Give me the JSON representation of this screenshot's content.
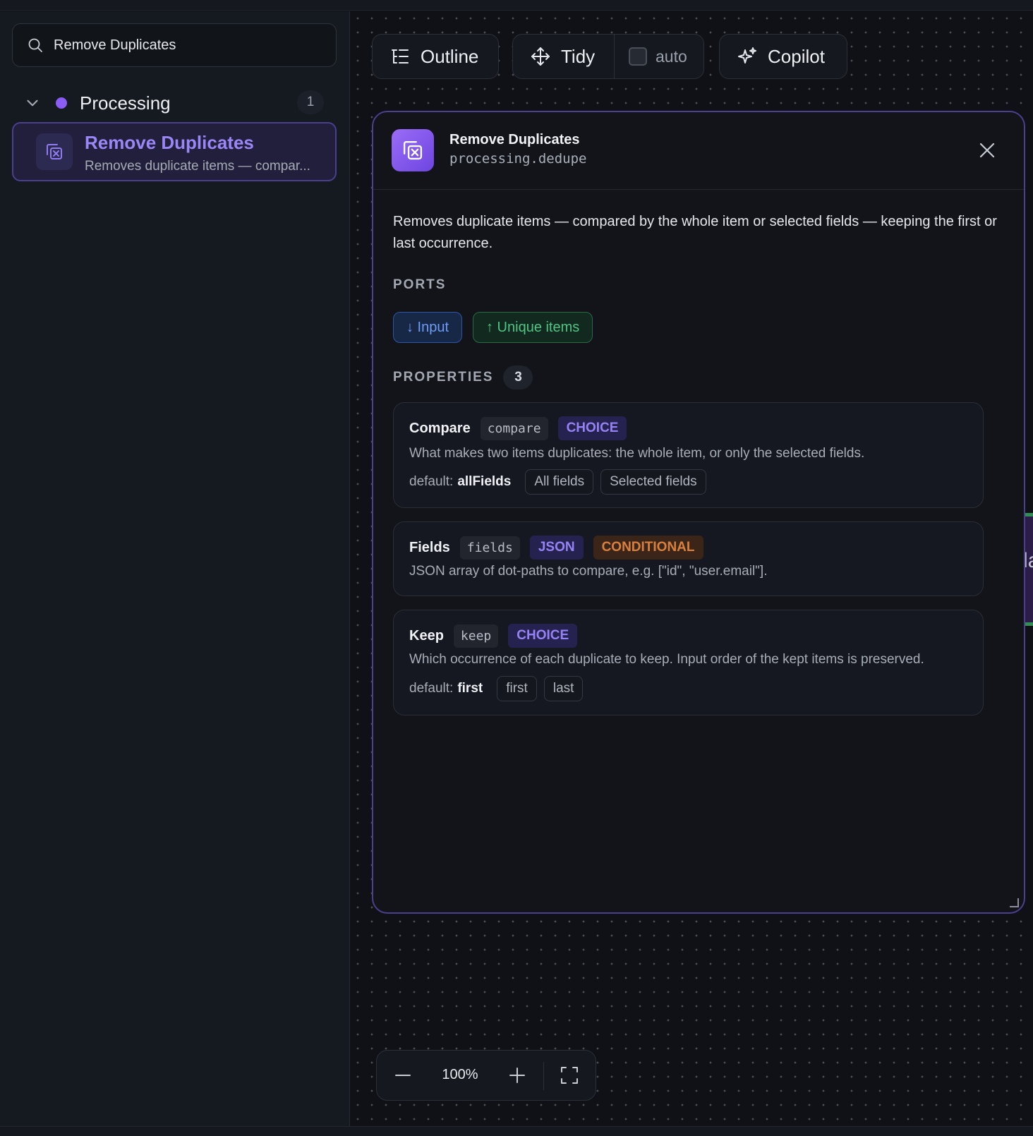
{
  "search": {
    "value": "Remove Duplicates"
  },
  "group": {
    "title": "Processing",
    "count": "1",
    "dot_color": "#8b5cf6"
  },
  "node_item": {
    "title": "Remove Duplicates",
    "desc": "Removes duplicate items — compar..."
  },
  "toolbar": {
    "outline_label": "Outline",
    "tidy_label": "Tidy",
    "auto_label": "auto",
    "copilot_label": "Copilot"
  },
  "panel": {
    "title": "Remove Duplicates",
    "id": "processing.dedupe",
    "description": "Removes duplicate items — compared by the whole item or selected fields — keeping the first or last occurrence.",
    "ports_label": "PORTS",
    "ports": [
      {
        "label": "↓ Input",
        "kind": "input"
      },
      {
        "label": "↑ Unique items",
        "kind": "output"
      }
    ],
    "properties_label": "PROPERTIES",
    "properties_count": "3",
    "properties": [
      {
        "name": "Compare",
        "key": "compare",
        "type": "CHOICE",
        "description": "What makes two items duplicates: the whole item, or only the selected fields.",
        "default_label": "default:",
        "default_value": "allFields",
        "options": [
          "All fields",
          "Selected fields"
        ]
      },
      {
        "name": "Fields",
        "key": "fields",
        "type": "JSON",
        "badge": "CONDITIONAL",
        "description": "JSON array of dot-paths to compare, e.g. [\"id\", \"user.email\"]."
      },
      {
        "name": "Keep",
        "key": "keep",
        "type": "CHOICE",
        "description": "Which occurrence of each duplicate to keep. Input order of the kept items is preserved.",
        "default_label": "default:",
        "default_value": "first",
        "options": [
          "first",
          "last"
        ]
      }
    ]
  },
  "edge_fragment": {
    "text": "la"
  },
  "zoom": {
    "value": "100%"
  },
  "colors": {
    "accent": "#8b5cf6",
    "border_accent": "#4b3f8f",
    "input_port": "#6f9cf3",
    "output_port": "#4fc483",
    "conditional": "#d9803f"
  }
}
